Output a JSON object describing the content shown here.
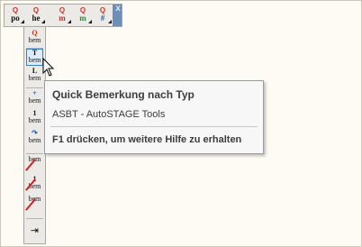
{
  "top_toolbar": {
    "buttons": [
      {
        "sup": "Q",
        "main": "po",
        "color": "#c0392b"
      },
      {
        "sup": "Q",
        "main": "he",
        "color": "#c0392b"
      },
      {
        "sup": "Q",
        "main": "m",
        "color": "#c0392b"
      },
      {
        "sup": "Q",
        "main": "m",
        "color": "#2e8b3a"
      },
      {
        "sup": "Q",
        "main": "#",
        "color": "#2c5aa0"
      }
    ],
    "close_glyph": "x"
  },
  "vertical_toolbar": {
    "buttons": [
      {
        "l1": "Q",
        "l2": "bem"
      },
      {
        "l1": "T",
        "l2": "bem"
      },
      {
        "l1": "L",
        "l2": "bem"
      },
      {
        "l1": "+",
        "l2": "bem"
      },
      {
        "l1": "1",
        "l2": "bem"
      },
      {
        "l1": "↷",
        "l2": "bem"
      },
      {
        "l1": "",
        "l2": "bem"
      },
      {
        "l1": "1",
        "l2": "bem"
      },
      {
        "l1": "",
        "l2": "bem"
      },
      {
        "l1": "⇥",
        "l2": ""
      }
    ]
  },
  "tooltip": {
    "title": "Quick Bemerkung nach Typ",
    "source": "ASBT - AutoSTAGE Tools",
    "help": "F1 drücken, um weitere Hilfe zu erhalten"
  }
}
